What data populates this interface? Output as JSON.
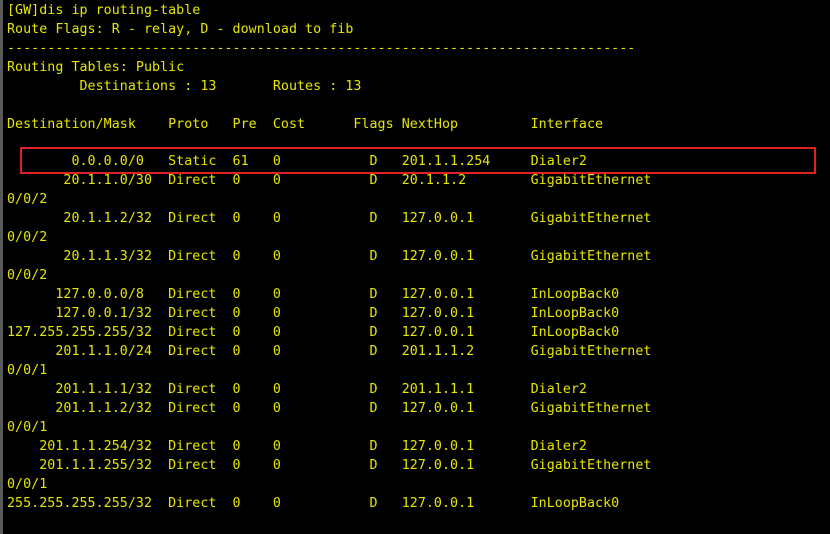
{
  "terminal": {
    "command_line": "[GW]dis ip routing-table",
    "flags_legend": "Route Flags: R - relay, D - download to fib",
    "separator": "------------------------------------------------------------------------------",
    "tables_title": "Routing Tables: Public",
    "summary": "         Destinations : 13       Routes : 13",
    "header": "Destination/Mask    Proto   Pre  Cost      Flags NextHop         Interface",
    "rows": [
      "        0.0.0.0/0   Static  61   0           D   201.1.1.254     Dialer2",
      "       20.1.1.0/30  Direct  0    0           D   20.1.1.2        GigabitEthernet",
      "0/0/2",
      "       20.1.1.2/32  Direct  0    0           D   127.0.0.1       GigabitEthernet",
      "0/0/2",
      "       20.1.1.3/32  Direct  0    0           D   127.0.0.1       GigabitEthernet",
      "0/0/2",
      "      127.0.0.0/8   Direct  0    0           D   127.0.0.1       InLoopBack0",
      "      127.0.0.1/32  Direct  0    0           D   127.0.0.1       InLoopBack0",
      "127.255.255.255/32  Direct  0    0           D   127.0.0.1       InLoopBack0",
      "      201.1.1.0/24  Direct  0    0           D   201.1.1.2       GigabitEthernet",
      "0/0/1",
      "      201.1.1.1/32  Direct  0    0           D   201.1.1.1       Dialer2",
      "      201.1.1.2/32  Direct  0    0           D   127.0.0.1       GigabitEthernet",
      "0/0/1",
      "    201.1.1.254/32  Direct  0    0           D   127.0.0.1       Dialer2",
      "    201.1.1.255/32  Direct  0    0           D   127.0.0.1       GigabitEthernet",
      "0/0/1",
      "255.255.255.255/32  Direct  0    0           D   127.0.0.1       InLoopBack0"
    ]
  },
  "colors": {
    "background": "#000000",
    "text": "#e6e600",
    "highlight": "#e0211f"
  }
}
